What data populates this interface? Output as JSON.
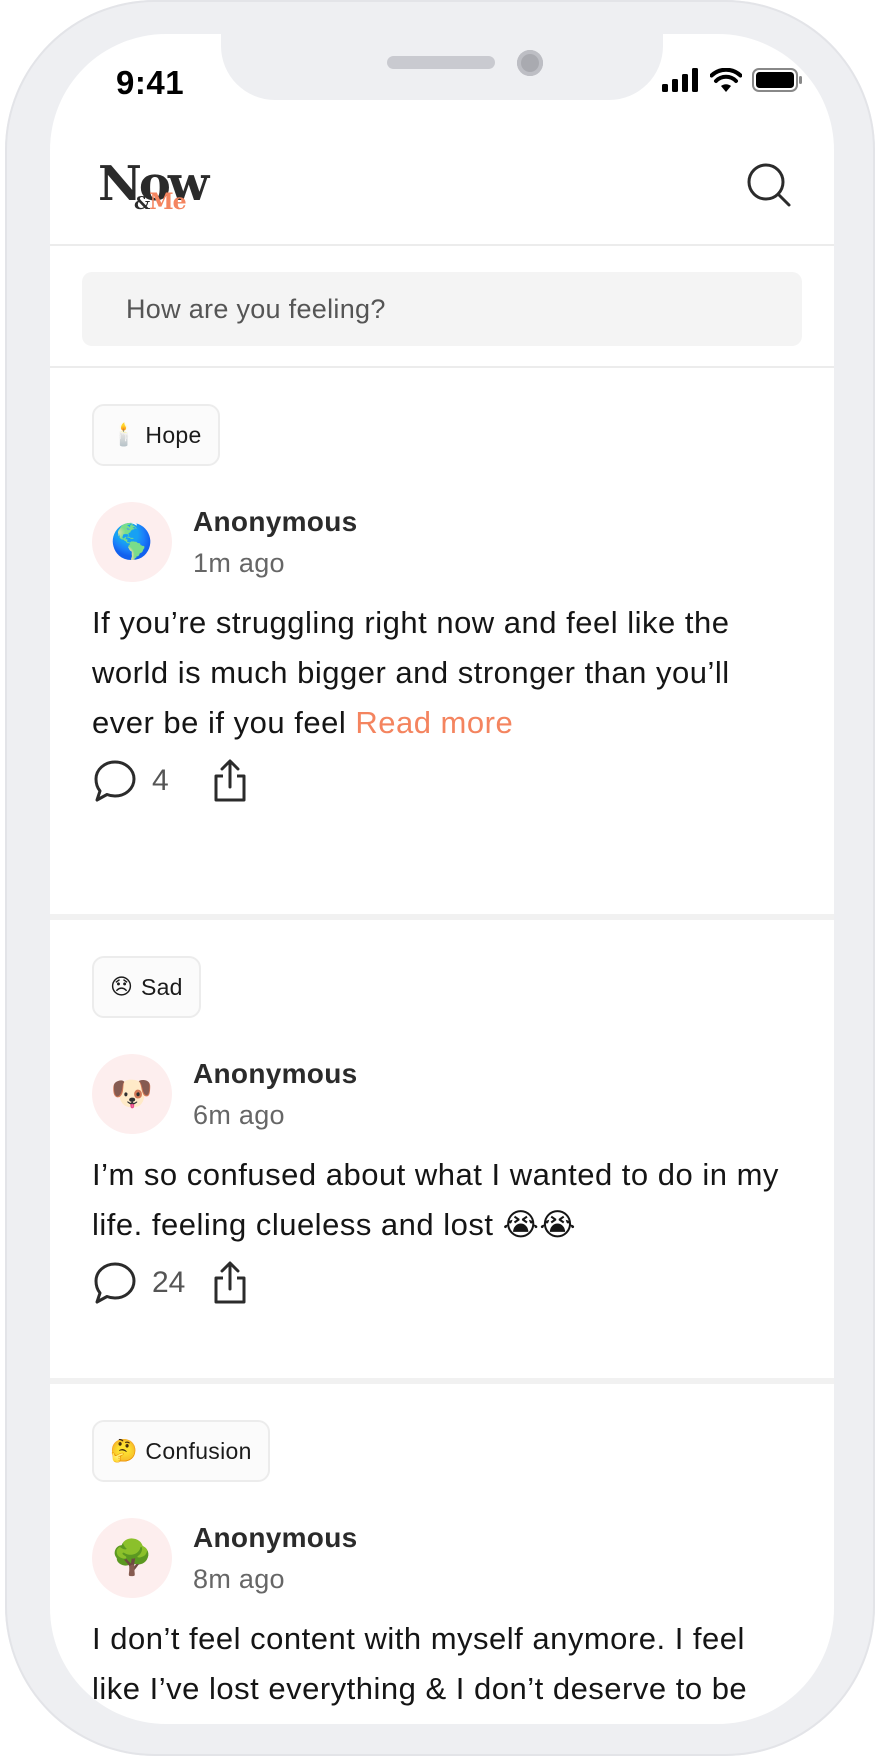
{
  "status_bar": {
    "time": "9:41"
  },
  "app": {
    "logo_main": "Now",
    "logo_amp": "&",
    "logo_sub": "Me"
  },
  "compose": {
    "placeholder": "How are you feeling?"
  },
  "colors": {
    "accent": "#f4845f",
    "avatar_bg": "#fdeeee"
  },
  "posts": [
    {
      "tag_emoji": "🕯️",
      "tag_label": "Hope",
      "avatar_emoji": "🌎",
      "author": "Anonymous",
      "time": "1m ago",
      "text": "If you’re struggling right now and feel like the world is much bigger and stronger than you’ll ever be if you feel",
      "read_more": "Read more",
      "comments": "4"
    },
    {
      "tag_emoji": "😞",
      "tag_label": "Sad",
      "avatar_emoji": "🐶",
      "author": "Anonymous",
      "time": "6m ago",
      "text": "I’m so confused about what I wanted to do in my life. feeling clueless and lost 😭😭",
      "comments": "24"
    },
    {
      "tag_emoji": "🤔",
      "tag_label": "Confusion",
      "avatar_emoji": "🌳",
      "author": "Anonymous",
      "time": "8m ago",
      "text": "I don’t feel content with myself anymore. I feel like I’ve lost everything & I don’t deserve to be happy"
    }
  ]
}
